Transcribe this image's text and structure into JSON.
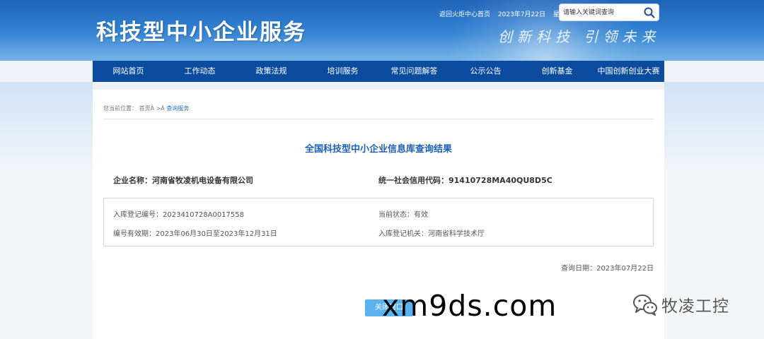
{
  "header": {
    "site_title": "科技型中小企业服务",
    "slogan": "创新科技 引领未来",
    "top_link": "返回火炬中心首页",
    "top_date": "2023年7月22日",
    "top_weekday": "星期六",
    "search": {
      "placeholder": "请输入关键词查询"
    }
  },
  "nav": {
    "items": [
      {
        "label": "网站首页"
      },
      {
        "label": "工作动态"
      },
      {
        "label": "政策法规"
      },
      {
        "label": "培训服务"
      },
      {
        "label": "常见问题解答"
      },
      {
        "label": "公示公告"
      },
      {
        "label": "创新基金"
      },
      {
        "label": "中国创新创业大赛"
      }
    ]
  },
  "breadcrumb": {
    "prefix": "您当前位置：",
    "home": "首页Â",
    "sep": " >Â ",
    "current": "查询服务"
  },
  "result": {
    "title": "全国科技型中小企业信息库查询结果",
    "company_name": "企业名称：河南省牧凌机电设备有限公司",
    "credit_code": "统一社会信用代码：91410728MA40QU8D5C",
    "reg_number": "入库登记编号：2023410728A0017558",
    "status": "当前状态：有效",
    "validity": "编号有效期：2023年06月30日至2023年12月31日",
    "authority": "入库登记机关：河南省科学技术厅",
    "query_date": "查询日期：2023年07月22日",
    "close_label": "关闭窗口"
  },
  "watermarks": {
    "url": "xm9ds.com",
    "brand": "牧凌工控"
  },
  "colors": {
    "nav_bg": "#0b4c9e",
    "title_blue": "#1a5fb4",
    "button_blue": "#5ab3f0"
  }
}
